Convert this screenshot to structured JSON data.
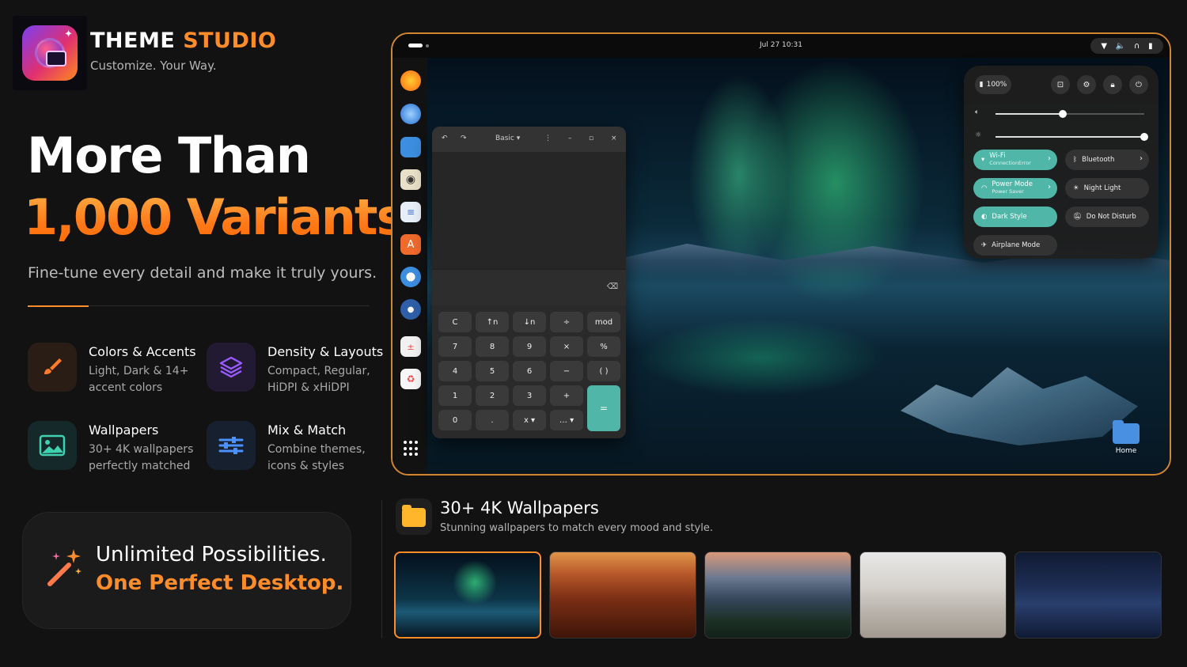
{
  "brand": {
    "title_white": "THEME",
    "title_orange": "STUDIO",
    "subtitle": "Customize. Your Way."
  },
  "hero": {
    "line1": "More Than",
    "line2": "1,000 Variants",
    "tagline": "Fine-tune every detail and make it truly yours."
  },
  "features": [
    {
      "title": "Colors & Accents",
      "desc": "Light, Dark & 14+ accent colors",
      "icon": "paintbrush-icon",
      "color": "#ff7a2a"
    },
    {
      "title": "Density & Layouts",
      "desc": "Compact, Regular, HiDPI & xHiDPI",
      "icon": "layers-icon",
      "color": "#9b5cff"
    },
    {
      "title": "Wallpapers",
      "desc": "30+ 4K wallpapers perfectly matched",
      "icon": "image-icon",
      "color": "#3fd1b0"
    },
    {
      "title": "Mix & Match",
      "desc": "Combine themes, icons & styles",
      "icon": "sliders-icon",
      "color": "#4a90ff"
    }
  ],
  "cta": {
    "line1": "Unlimited Possibilities.",
    "line2": "One Perfect Desktop."
  },
  "desktop": {
    "clock": "Jul 27  10:31",
    "calculator": {
      "mode": "Basic",
      "keys": [
        "C",
        "↑n",
        "↓n",
        "÷",
        "mod",
        "7",
        "8",
        "9",
        "×",
        "%",
        "4",
        "5",
        "6",
        "−",
        "( )",
        "1",
        "2",
        "3",
        "+",
        "0",
        ".",
        "x ▾",
        "… ▾",
        "="
      ]
    },
    "quick_settings": {
      "battery": "100%",
      "volume_level": 0.45,
      "brightness_level": 1.0,
      "tiles": [
        {
          "label": "Wi-Fi",
          "sub": "ConnectionError",
          "on": true,
          "chevron": true
        },
        {
          "label": "Bluetooth",
          "sub": "",
          "on": false,
          "chevron": true
        },
        {
          "label": "Power Mode",
          "sub": "Power Saver",
          "on": true,
          "chevron": true
        },
        {
          "label": "Night Light",
          "sub": "",
          "on": false,
          "chevron": false
        },
        {
          "label": "Dark Style",
          "sub": "",
          "on": true,
          "chevron": false
        },
        {
          "label": "Do Not Disturb",
          "sub": "",
          "on": false,
          "chevron": false
        },
        {
          "label": "Airplane Mode",
          "sub": "",
          "on": false,
          "chevron": false
        }
      ]
    },
    "home_label": "Home",
    "accent": "#4fb6a8"
  },
  "wallpapers": {
    "title": "30+ 4K Wallpapers",
    "subtitle": "Stunning wallpapers to match every mood and style.",
    "thumbs": [
      "aurora",
      "canyon",
      "misty-hills",
      "dunes",
      "night-mountains"
    ],
    "selected_index": 0
  },
  "colors": {
    "accent_orange": "#ff8c2a",
    "monitor_border": "#d4862e"
  }
}
